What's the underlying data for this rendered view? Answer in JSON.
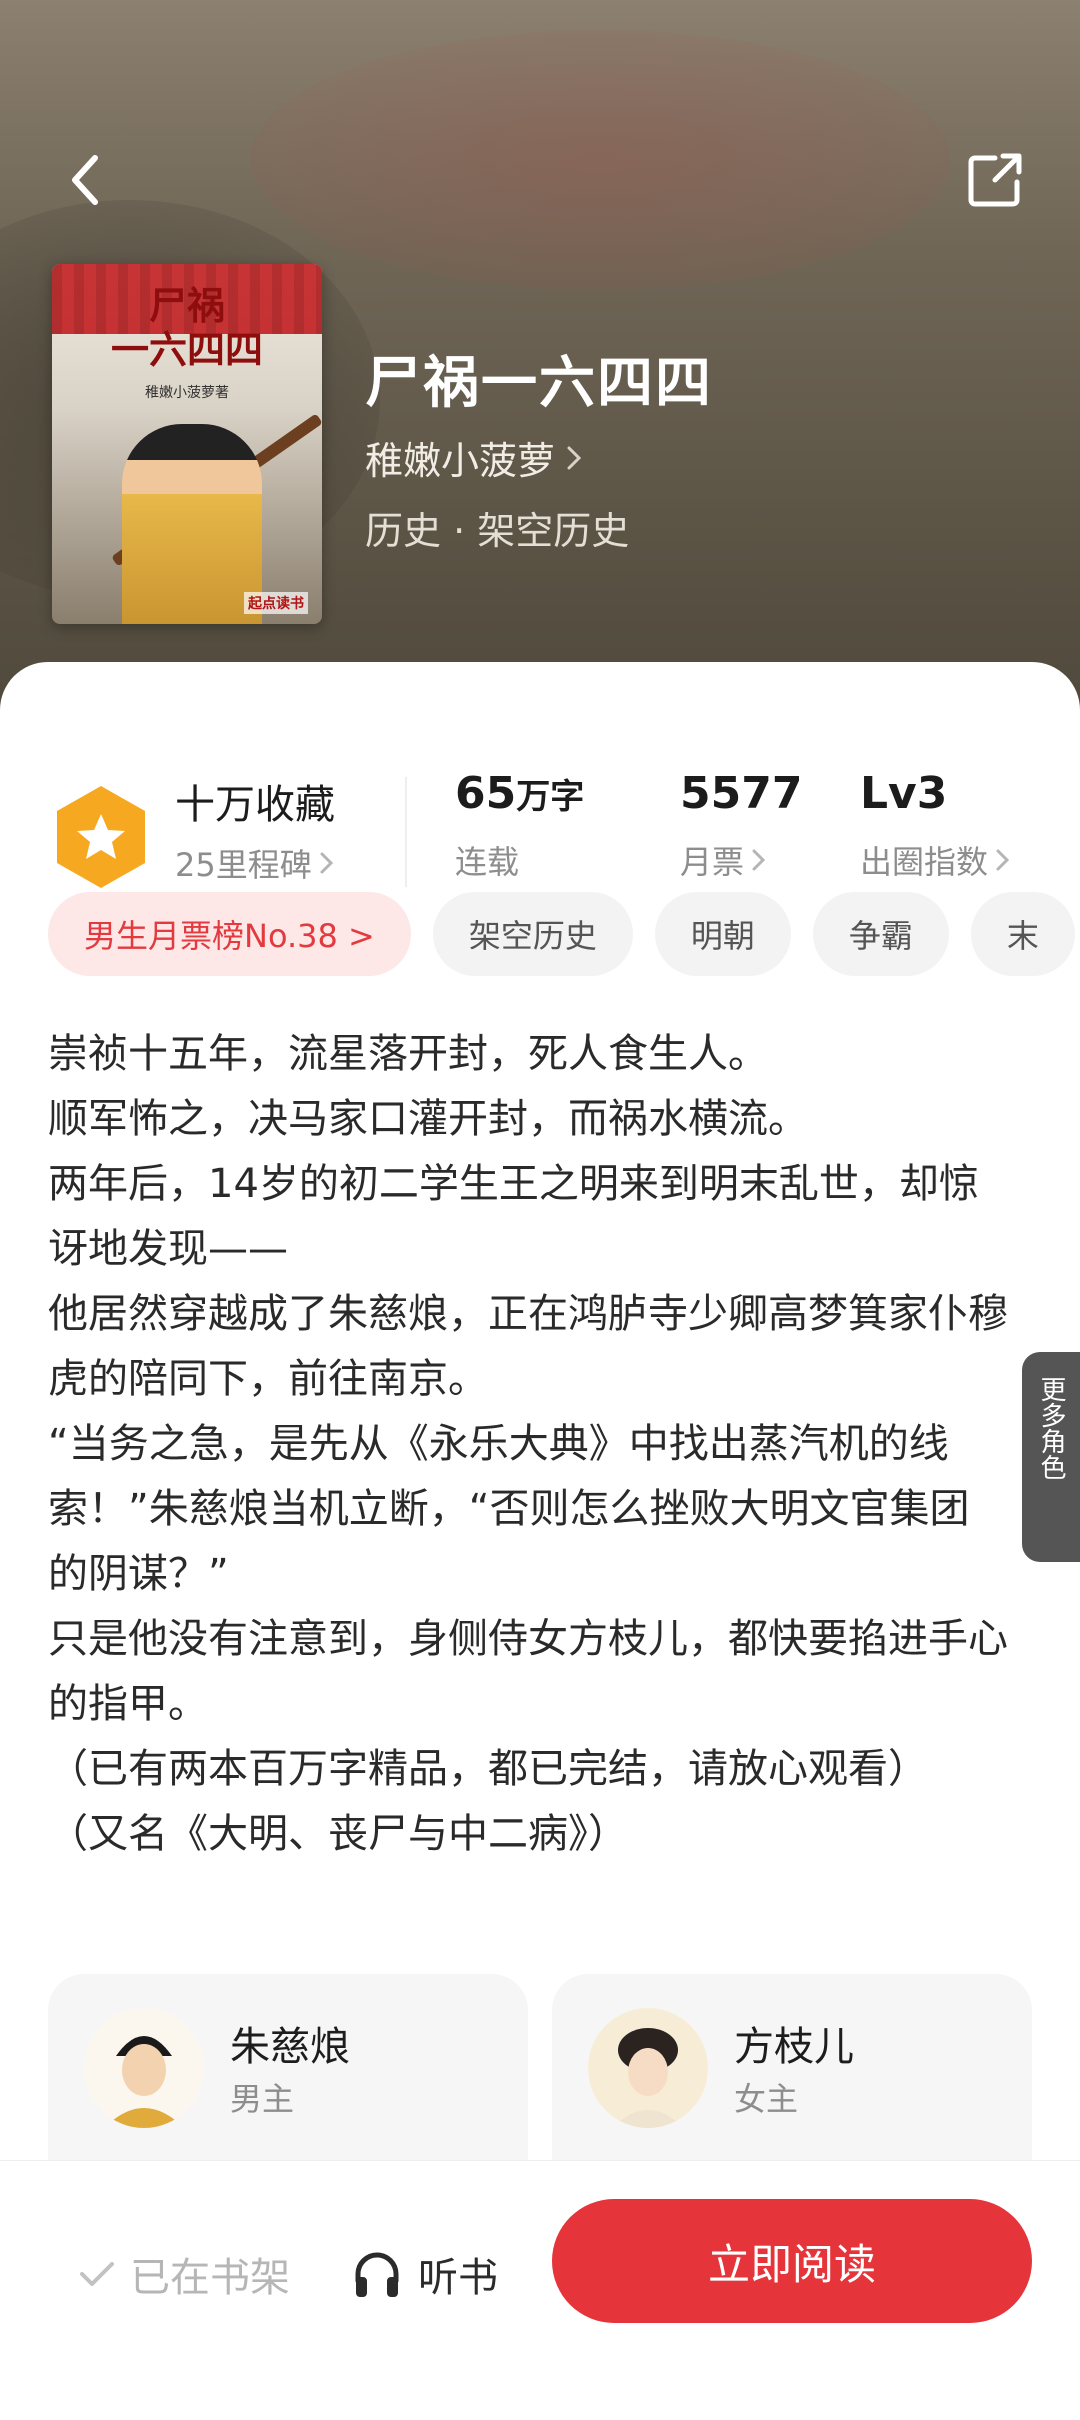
{
  "header": {
    "back_icon": "chevron-left-icon",
    "share_icon": "share-icon"
  },
  "book": {
    "title": "尸祸一六四四",
    "author": "稚嫩小菠萝",
    "genre": "历史 · 架空历史",
    "cover_title_line1": "尸祸",
    "cover_title_line2": "一六四四",
    "cover_author": "稚嫩小菠萝著",
    "cover_publisher": "起点读书"
  },
  "stats": {
    "collect_main": "十万收藏",
    "collect_sub": "25里程碑",
    "words_value": "65",
    "words_unit": "万字",
    "words_sub": "连载",
    "tickets_value": "5577",
    "tickets_sub": "月票",
    "level_value": "Lv3",
    "level_sub": "出圈指数"
  },
  "tags": [
    "男生月票榜No.38 >",
    "架空历史",
    "明朝",
    "争霸",
    "末"
  ],
  "synopsis": [
    "崇祯十五年，流星落开封，死人食生人。",
    "顺军怖之，决马家口灌开封，而祸水横流。",
    "两年后，14岁的初二学生王之明来到明末乱世，却惊讶地发现——",
    "他居然穿越成了朱慈烺，正在鸿胪寺少卿高梦箕家仆穆虎的陪同下，前往南京。",
    "“当务之急，是先从《永乐大典》中找出蒸汽机的线索！”朱慈烺当机立断，“否则怎么挫败大明文官集团的阴谋？”",
    "只是他没有注意到，身侧侍女方枝儿，都快要掐进手心的指甲。",
    "（已有两本百万字精品，都已完结，请放心观看）",
    "（又名《大明、丧尸与中二病》）"
  ],
  "characters": [
    {
      "name": "朱慈烺",
      "role": "男主"
    },
    {
      "name": "方枝儿",
      "role": "女主"
    }
  ],
  "more_roles": "更多角色",
  "bottom": {
    "shelf_label": "已在书架",
    "listen_label": "听书",
    "read_label": "立即阅读"
  },
  "colors": {
    "accent": "#e5343a",
    "badge": "#f7a821",
    "hot_tag_bg": "#fde7e7"
  }
}
